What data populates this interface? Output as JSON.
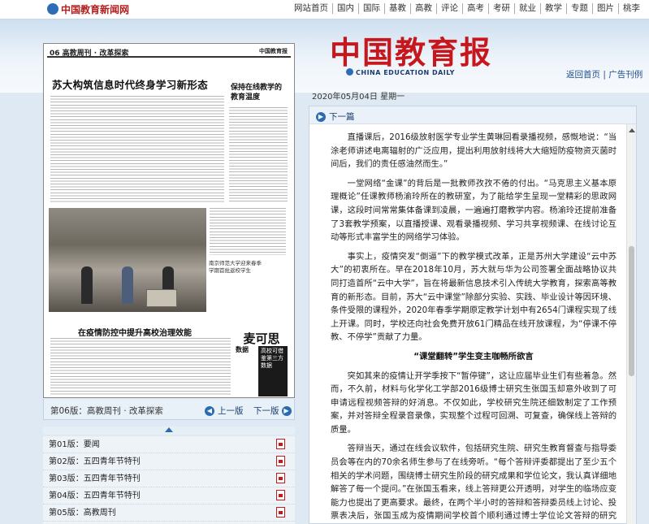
{
  "site": {
    "logo_text": "中国教育新闻网"
  },
  "topnav": [
    "网站首页",
    "国内",
    "国际",
    "基教",
    "高教",
    "评论",
    "高考",
    "考研",
    "就业",
    "教学",
    "专题",
    "图片",
    "桃李"
  ],
  "banner": {
    "brand": "中国教育报",
    "brand_sub": "CHINA EDUCATION DAILY",
    "back_home": "返回首页",
    "separator": " | ",
    "ad_list": "广告刊例"
  },
  "newspaper_page": {
    "section": "06 高教周刊 · 改革探索",
    "paper": "中国教育报",
    "headline": "苏大构筑信息时代终身学习新形态",
    "side_headline": "保持在线教学的教育温度",
    "photo_caption": "南京师范大学迎来春季学期首批返校学生",
    "sub_headline": "在疫情防控中提升高校治理效能",
    "column_name": "麦可思",
    "column_vertical_1": "高校可借鉴第三方数据",
    "column_vertical_2": "数据"
  },
  "page_bar": {
    "current": "第06版：高教周刊 · 改革探索",
    "prev": "上一版",
    "next": "下一版",
    "prev_icon": "◀",
    "next_icon": "▶"
  },
  "editions": [
    {
      "label": "第01版：要闻"
    },
    {
      "label": "第02版：五四青年节特刊"
    },
    {
      "label": "第03版：五四青年节特刊"
    },
    {
      "label": "第04版：五四青年节特刊"
    },
    {
      "label": "第05版：高教周刊"
    }
  ],
  "date": "2020年05月04日  星期一",
  "article": {
    "next_label": "下一篇",
    "next_icon": "▶",
    "paragraphs": [
      "直播课后，2016级放射医学专业学生黄琳回看录播视频，感慨地说：“当涂老师讲述电离辐射的广泛应用，提出利用放射线将大大缩短防疫物资灭菌时间后，我们的责任感油然而生。”",
      "一堂网络“金课”的背后是一批教师孜孜不倦的付出。“马克思主义基本原理概论”任课教师杨渝玲所在的教研室，为了能给学生呈现一堂精彩的思政网课，这段时间常常集体备课到凌晨，一遍遍打磨教学内容。杨渝玲还提前准备了3套教学预案，以直播授课、观看录播视频、学习共享视频课、在线讨论互动等形式丰富学生的网络学习体验。",
      "事实上，疫情突发“倒逼”下的教学模式改革，正是苏州大学建设“云中苏大”的初衷所在。早在2018年10月，苏大就与华为公司签署全面战略协议共同打造首所“云中大学”，旨在将最新信息技术引入传统大学教育，探索高等教育的新形态。目前，苏大“云中课堂”除部分实验、实践、毕业设计等因环境、条件受限的课程外，2020年春季学期原定教学计划中有2654门课程实现了线上开课。同时，学校还向社会免费开放61门精品在线开放课程，为“停课不停教、不停学”贡献了力量。"
    ],
    "subheading": "“课堂翻转”学生变主咖畅所欲言",
    "paragraphs2": [
      "突如其来的疫情让开学季按下“暂停键”，这让应届毕业生们有些着急。然而，不久前，材料与化学化工学部2016级博士研究生张国玉却意外收到了可申请远程视频答辩的好消息。不仅如此，学校研究生院还细致制定了工作预案，并对答辩全程录音录像，实现整个过程可回溯、可复查，确保线上答辩的质量。",
      "答辩当天，通过在线会议软件，包括研究生院、研究生教育督查与指导委员会等在内的70余名师生参与了在线旁听。“每个答辩评委都提出了至少五个相关的学术问题，围绕博士研究生阶段的研究成果和学位论文，我认真详细地解答了每一个提问。”在张国玉看来，线上答辩更公开透明，对学生的临场应变能力也提出了更高要求。最终，在两个半小时的答辩和答辩委员线上讨论、投票表决后，张国玉成为疫情期间学校首个顺利通过博士学位论文答辩的研究生。"
    ]
  },
  "colors": {
    "brand_red": "#c8161d",
    "link_blue": "#1a3d6e",
    "accent_blue": "#2a6cb0"
  },
  "icons": [
    "logo-mark-icon",
    "prev-arrow-icon",
    "next-arrow-icon",
    "pdf-icon",
    "collapse-triangle-icon",
    "scroll-up-icon"
  ]
}
